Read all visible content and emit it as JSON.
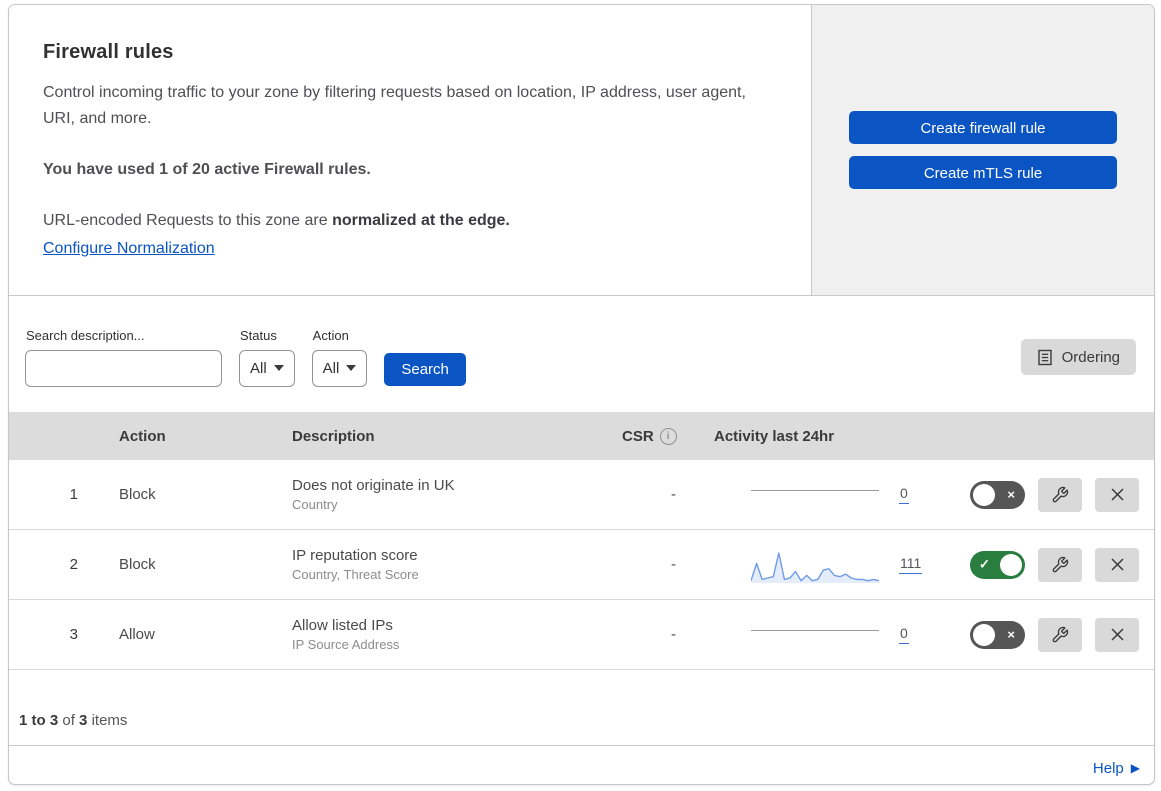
{
  "colors": {
    "accent_blue": "#0a55c3",
    "toggle_on_green": "#287d3f",
    "toggle_off_gray": "#565656",
    "panel_gray": "#f0f0f0",
    "table_header_gray": "#dcdcdc",
    "sparkline_blue": "#6f9bea"
  },
  "header": {
    "title": "Firewall rules",
    "description": "Control incoming traffic to your zone by filtering requests based on location, IP address, user agent, URI, and more.",
    "usage": "You have used 1 of 20 active Firewall rules.",
    "normalization_prefix": "URL-encoded Requests to this zone are ",
    "normalization_bold": "normalized at the edge.",
    "normalization_link": "Configure Normalization",
    "create_firewall_button": "Create firewall rule",
    "create_mtls_button": "Create mTLS rule"
  },
  "filters": {
    "search_label": "Search description...",
    "status_label": "Status",
    "status_value": "All",
    "action_label": "Action",
    "action_value": "All",
    "search_button": "Search",
    "ordering_button": "Ordering"
  },
  "table": {
    "columns": {
      "action": "Action",
      "description": "Description",
      "csr": "CSR",
      "activity": "Activity last 24hr"
    },
    "rows": [
      {
        "number": "1",
        "action": "Block",
        "description": "Does not originate in UK",
        "criteria": "Country",
        "csr": "-",
        "activity_count": "0",
        "enabled": false
      },
      {
        "number": "2",
        "action": "Block",
        "description": "IP reputation score",
        "criteria": "Country, Threat Score",
        "csr": "-",
        "activity_count": "111",
        "enabled": true
      },
      {
        "number": "3",
        "action": "Allow",
        "description": "Allow listed IPs",
        "criteria": "IP Source Address",
        "csr": "-",
        "activity_count": "0",
        "enabled": false
      }
    ],
    "summary": {
      "range": "1 to 3",
      "of": "of",
      "total": "3",
      "items": "items"
    }
  },
  "footer": {
    "help_label": "Help"
  },
  "glyphs": {
    "caret_down": "▼",
    "toggle_x": "×",
    "toggle_check": "✓",
    "help_arrow": "▶",
    "info": "i"
  },
  "chart_data": {
    "type": "line",
    "subtype": "sparkline",
    "title": "Activity last 24hr",
    "series_name": "IP reputation score",
    "values": [
      1,
      14,
      2,
      3,
      4,
      22,
      2,
      3,
      8,
      1,
      5,
      1,
      2,
      9,
      10,
      5,
      4,
      6,
      3,
      2,
      2,
      1,
      2,
      1
    ],
    "total": 111,
    "xlabel": "",
    "ylabel": "",
    "axes_hidden": true,
    "grid": false,
    "legend": false
  }
}
